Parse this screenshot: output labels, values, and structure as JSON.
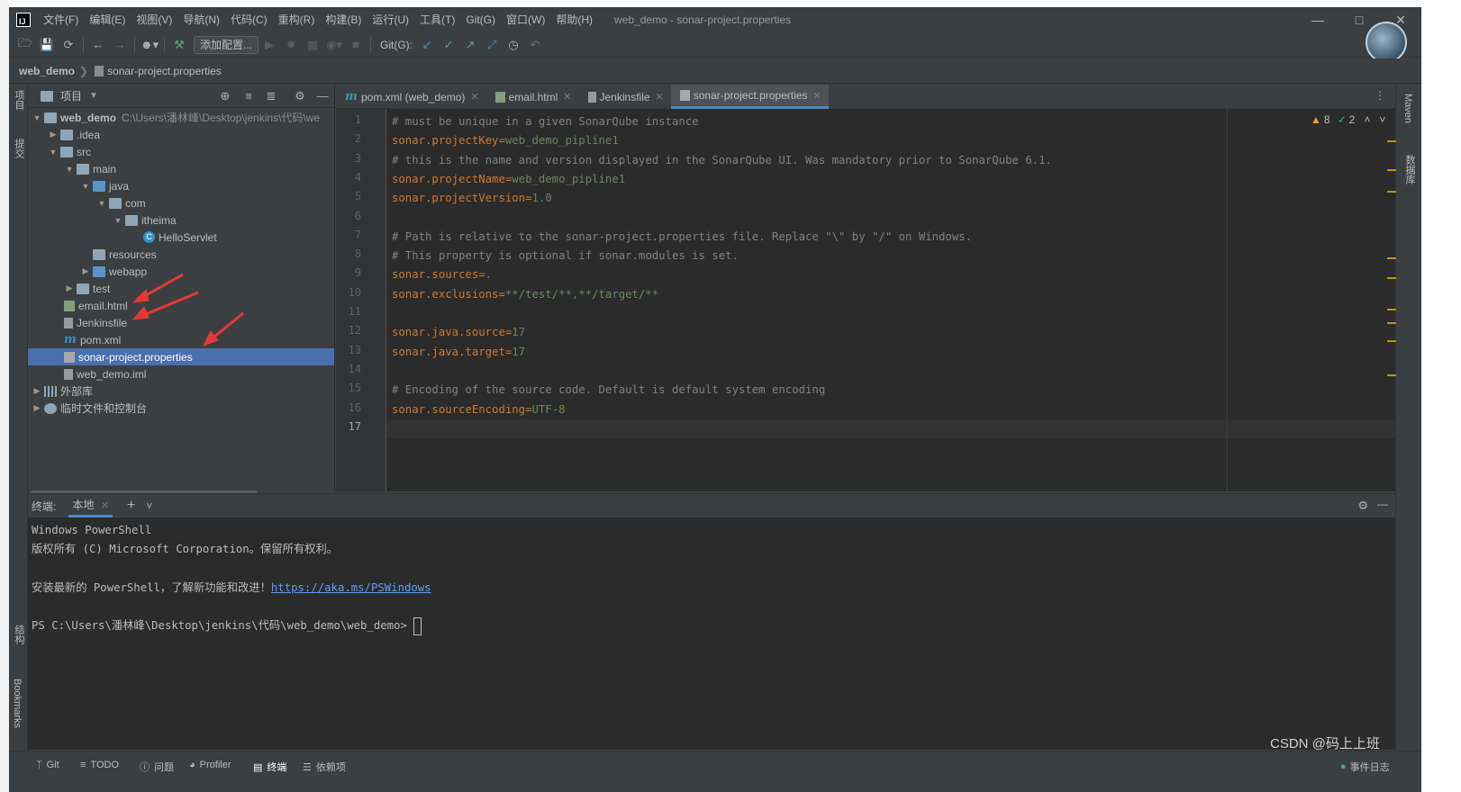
{
  "menu": [
    "文件(F)",
    "编辑(E)",
    "视图(V)",
    "导航(N)",
    "代码(C)",
    "重构(R)",
    "构建(B)",
    "运行(U)",
    "工具(T)",
    "Git(G)",
    "窗口(W)",
    "帮助(H)"
  ],
  "window_title": "web_demo - sonar-project.properties",
  "toolbar": {
    "add_config_label": "添加配置...",
    "git_label": "Git(G):"
  },
  "breadcrumb": {
    "project": "web_demo",
    "file": "sonar-project.properties"
  },
  "left_stripe": {
    "project_label": "项目",
    "commit_label": "提交",
    "structure_label": "结构",
    "bookmarks_label": "Bookmarks"
  },
  "right_stripe": {
    "maven_label": "Maven",
    "database_label": "数据库"
  },
  "project_panel": {
    "title": "项目",
    "root_name": "web_demo",
    "root_path": "C:\\Users\\潘林峰\\Desktop\\jenkins\\代码\\we",
    "items": [
      ".idea",
      "src",
      "main",
      "java",
      "com",
      "itheima",
      "HelloServlet",
      "resources",
      "webapp",
      "test",
      "email.html",
      "Jenkinsfile",
      "pom.xml",
      "sonar-project.properties",
      "web_demo.iml",
      "外部库",
      "临时文件和控制台"
    ]
  },
  "tabs": [
    {
      "label": "pom.xml (web_demo)"
    },
    {
      "label": "email.html"
    },
    {
      "label": "Jenkinsfile"
    },
    {
      "label": "sonar-project.properties"
    }
  ],
  "inspections": {
    "warnings": "8",
    "ok": "2"
  },
  "editor_lines": [
    {
      "n": "1",
      "key": "# must be unique in a given SonarQube instance",
      "val": ""
    },
    {
      "n": "2",
      "key": "sonar.projectKey=",
      "val": "web_demo_pipline1"
    },
    {
      "n": "3",
      "key": "# this is the name and version displayed in the SonarQube UI. Was mandatory prior to SonarQube 6.1.",
      "val": ""
    },
    {
      "n": "4",
      "key": "sonar.projectName=",
      "val": "web_demo_pipline1"
    },
    {
      "n": "5",
      "key": "sonar.projectVersion=",
      "val": "1.0"
    },
    {
      "n": "6",
      "key": "",
      "val": ""
    },
    {
      "n": "7",
      "key": "# Path is relative to the sonar-project.properties file. Replace \"\\\" by \"/\" on Windows.",
      "val": ""
    },
    {
      "n": "8",
      "key": "# This property is optional if sonar.modules is set.",
      "val": ""
    },
    {
      "n": "9",
      "key": "sonar.sources=",
      "val": "."
    },
    {
      "n": "10",
      "key": "sonar.exclusions=",
      "val": "**/test/**,**/target/**"
    },
    {
      "n": "11",
      "key": "",
      "val": ""
    },
    {
      "n": "12",
      "key": "sonar.java.source=",
      "val": "17"
    },
    {
      "n": "13",
      "key": "sonar.java.target=",
      "val": "17"
    },
    {
      "n": "14",
      "key": "",
      "val": ""
    },
    {
      "n": "15",
      "key": "# Encoding of the source code. Default is default system encoding",
      "val": ""
    },
    {
      "n": "16",
      "key": "sonar.sourceEncoding=",
      "val": "UTF-8"
    },
    {
      "n": "17",
      "key": "",
      "val": ""
    }
  ],
  "terminal": {
    "label": "终端:",
    "tab": "本地",
    "lines": [
      "Windows PowerShell",
      "版权所有 (C) Microsoft Corporation。保留所有权利。",
      "",
      "安装最新的 PowerShell，了解新功能和改进！",
      "",
      "PS C:\\Users\\潘林峰\\Desktop\\jenkins\\代码\\web_demo\\web_demo> "
    ],
    "link": "https://aka.ms/PSWindows"
  },
  "statusbar": {
    "items": [
      "Git",
      "TODO",
      "问题",
      "Profiler",
      "终端",
      "依赖项"
    ],
    "event_log": "事件日志"
  },
  "watermark": "CSDN @码上上班"
}
